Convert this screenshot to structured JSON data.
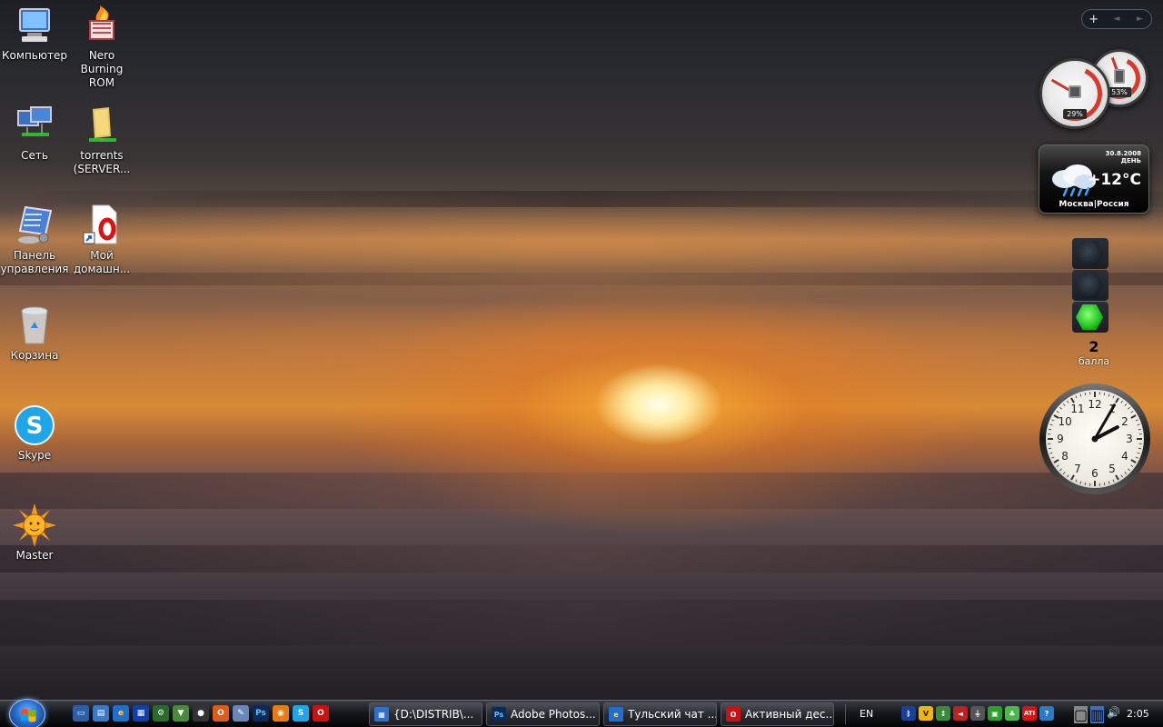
{
  "desktop": {
    "icons": [
      {
        "label": "Компьютер"
      },
      {
        "label": "Nero Burning ROM"
      },
      {
        "label": "Сеть"
      },
      {
        "label": "torrents (SERVER..."
      },
      {
        "label": "Панель управления"
      },
      {
        "label": "Мой домашн..."
      },
      {
        "label": "Корзина"
      },
      {
        "label": "Skype"
      },
      {
        "label": "Master"
      }
    ]
  },
  "sidebar": {
    "add_symbol": "+",
    "prev_symbol": "◄",
    "next_symbol": "►",
    "cpu_meter": {
      "cpu_percent": "29%",
      "memory_percent": "53%"
    },
    "weather": {
      "date": "30.8.2008",
      "period": "ДЕНЬ",
      "temperature": "+12°C",
      "location": "Москва|Россия"
    },
    "traffic": {
      "score": "2",
      "score_unit": "балла"
    },
    "clock": {
      "hour": 2,
      "minute": 5
    }
  },
  "taskbar": {
    "tasks": [
      {
        "label": "{D:\\DISTRIB\\...",
        "icon": "explorer-window-icon"
      },
      {
        "label": "Adobe Photos...",
        "icon": "photoshop-icon"
      },
      {
        "label": "Тульский чат ...",
        "icon": "internet-explorer-icon"
      },
      {
        "label": "Активный дес...",
        "icon": "opera-icon"
      }
    ],
    "language": "EN",
    "time": "2:05"
  },
  "colors": {
    "accent": "#2a6fd0",
    "taskbar": "#16181c",
    "sun": "#ffd27a"
  }
}
